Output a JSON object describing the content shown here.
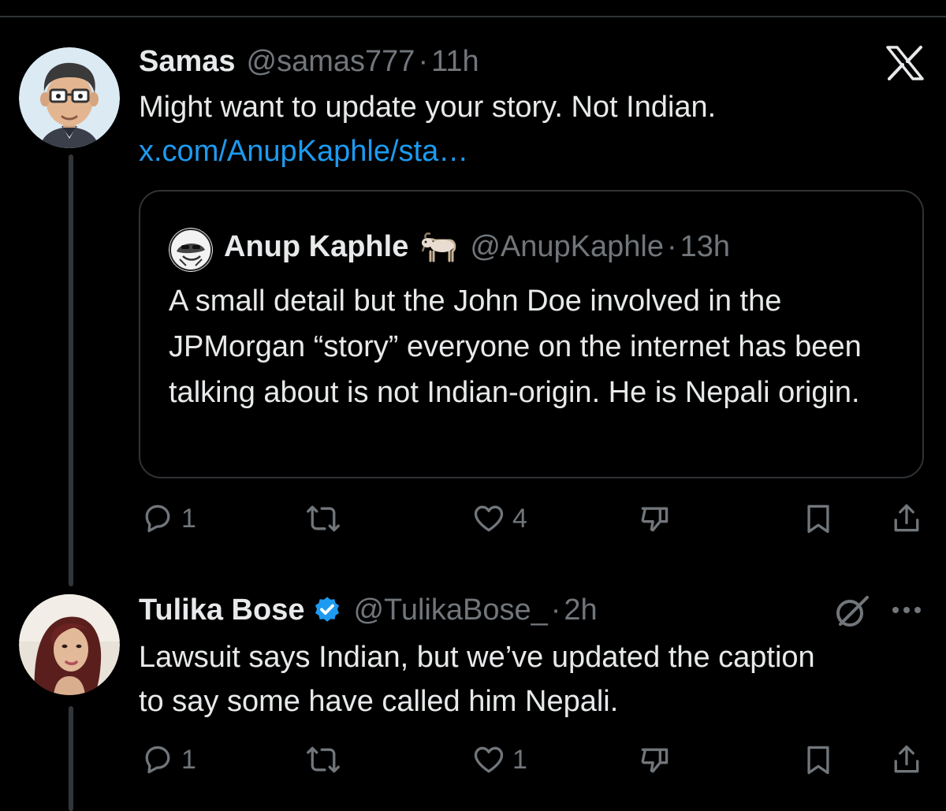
{
  "tweets": [
    {
      "name": "Samas",
      "handle": "@samas777",
      "dot": "·",
      "time": "11h",
      "text": "Might want to update your story. Not Indian.",
      "link": "x.com/AnupKaphle/sta…",
      "quote": {
        "name": "Anup Kaphle",
        "emoji": "goat",
        "handle": "@AnupKaphle",
        "dot": "·",
        "time": "13h",
        "text": "A small detail but the John Doe involved in the JPMorgan “story” everyone on the internet has been talking about is not Indian-origin. He is Nepali origin."
      },
      "actions": {
        "replies": "1",
        "reposts": "",
        "likes": "4"
      }
    },
    {
      "name": "Tulika Bose",
      "verified": true,
      "handle": "@TulikaBose_",
      "dot": "·",
      "time": "2h",
      "text": "Lawsuit says Indian, but we’ve updated the caption to say some have called him Nepali.",
      "actions": {
        "replies": "1",
        "reposts": "",
        "likes": "1"
      }
    }
  ],
  "icons": {
    "brand": "x-logo-icon",
    "reply": "reply-icon",
    "repost": "repost-icon",
    "like": "heart-icon",
    "dislike": "downvote-icon",
    "bookmark": "bookmark-icon",
    "share": "share-icon",
    "grok": "grok-icon",
    "more": "more-icon"
  },
  "colors": {
    "background": "#000000",
    "text": "#e7e9ea",
    "muted": "#71767b",
    "link": "#1d9bf0",
    "border": "#2f3336",
    "verified": "#1d9bf0"
  }
}
